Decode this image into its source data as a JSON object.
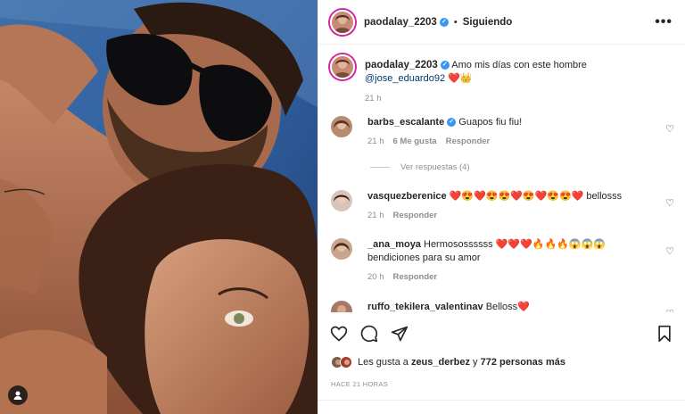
{
  "header": {
    "username": "paodalay_2203",
    "dot": "•",
    "follow_status": "Siguiendo",
    "more": "•••"
  },
  "caption": {
    "username": "paodalay_2203",
    "text": "Amo mis días con este hombre",
    "mention": "@jose_eduardo92",
    "emojis": "❤️👑",
    "time": "21 h"
  },
  "comments": [
    {
      "username": "barbs_escalante",
      "verified": true,
      "text": "Guapos fiu fiu!",
      "time": "21 h",
      "likes": "6 Me gusta",
      "reply": "Responder"
    },
    {
      "username": "vasquezberenice",
      "text": "❤️😍❤️😍😍❤️😍❤️😍😍❤️ bellosss",
      "time": "21 h",
      "reply": "Responder"
    },
    {
      "username": "_ana_moya",
      "text": "Hermosossssss ❤️❤️❤️🔥🔥🔥😱😱😱",
      "text2": "bendiciones para su amor",
      "time": "20 h",
      "reply": "Responder"
    },
    {
      "username": "ruffo_tekilera_valentinav",
      "text": "Belloss❤️"
    }
  ],
  "replies_label": "Ver respuestas (4)",
  "likes": {
    "prefix": "Les gusta a",
    "user": "zeus_derbez",
    "conj": "y",
    "others": "772 personas más"
  },
  "timestamp": "HACE 21 HORAS",
  "colors": {
    "accent": "#3897f0",
    "heart": "#ed4956",
    "muted": "#8e8e8e"
  },
  "icons": [
    "tag-user-icon",
    "more-icon",
    "heart-icon",
    "comment-icon",
    "share-icon",
    "save-icon"
  ]
}
